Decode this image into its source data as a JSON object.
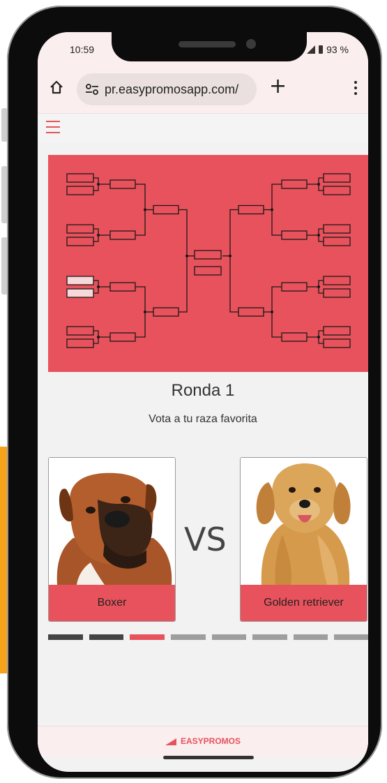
{
  "status_bar": {
    "time": "10:59",
    "battery": "93 %"
  },
  "browser": {
    "url": "pr.easypromosapp.com/"
  },
  "bracket": {
    "background": "#e8525c",
    "highlight": "#f8d7d9"
  },
  "round": {
    "title": "Ronda 1",
    "subtitle": "Vota a tu raza favorita"
  },
  "matchup": {
    "left": {
      "name": "Boxer"
    },
    "vs": "VS",
    "right": {
      "name": "Golden retriever"
    }
  },
  "progress": {
    "total": 8,
    "current": 3,
    "colors": {
      "done": "#444444",
      "current": "#e8525c",
      "pending": "#9e9e9e"
    }
  },
  "footer": {
    "brand": "EASYPROMOS"
  },
  "colors": {
    "accent": "#e8525c",
    "page_bg": "#f2f2f2",
    "side_accent": "#f7a21b"
  },
  "icons": [
    "home-icon",
    "tune-icon",
    "plus-icon",
    "more-vert-icon",
    "menu-icon",
    "signal-icon",
    "battery-icon",
    "easypromos-logo-icon"
  ]
}
